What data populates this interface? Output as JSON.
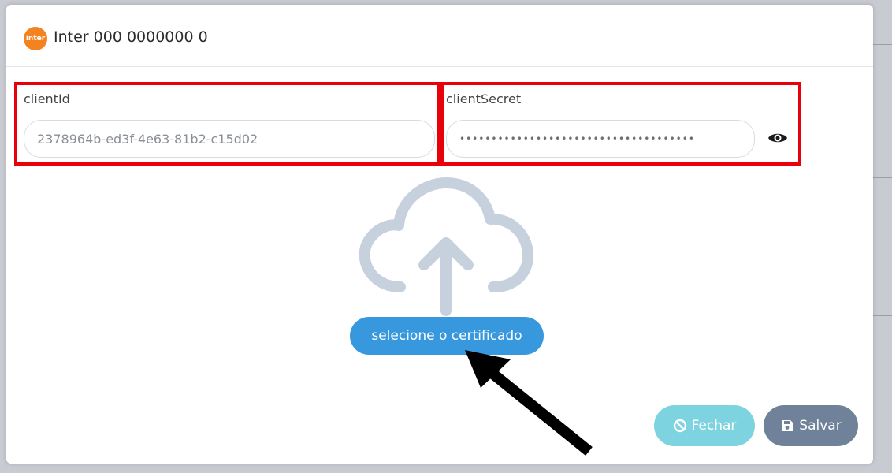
{
  "header": {
    "logo_text": "inter",
    "title": "Inter 000 0000000 0"
  },
  "fields": {
    "client_id": {
      "label": "clientId",
      "value": "2378964b-ed3f-4e63-81b2-c15d02"
    },
    "client_secret": {
      "label": "clientSecret",
      "value": "•••••••••••••••••••••••••••••••••••••"
    }
  },
  "upload": {
    "icon": "cloud-upload-icon",
    "button_label": "selecione o certificado"
  },
  "footer": {
    "close_label": "Fechar",
    "save_label": "Salvar",
    "close_icon": "ban-icon",
    "save_icon": "floppy-disk-icon"
  },
  "colors": {
    "highlight": "#e8000b",
    "upload_button": "#3898de",
    "close_button": "#7dd3df",
    "save_button": "#6f8299",
    "logo": "#f58220"
  }
}
